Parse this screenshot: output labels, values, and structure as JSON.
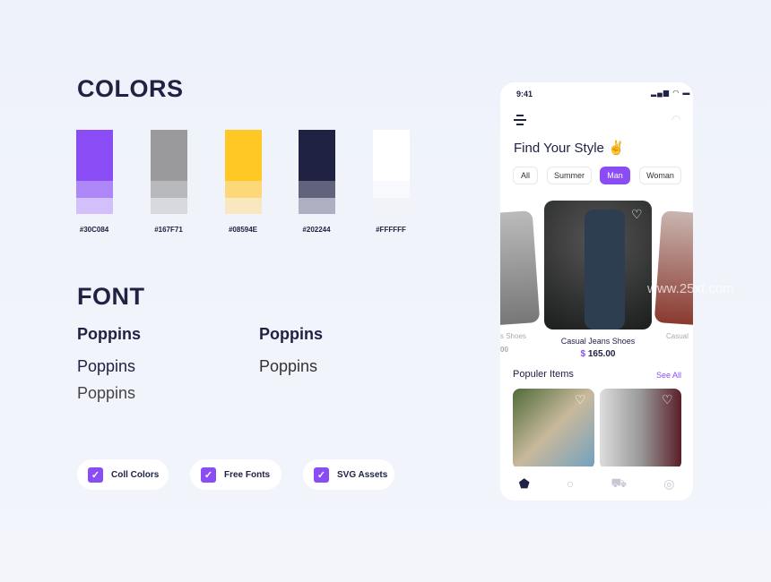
{
  "colors": {
    "title": "COLORS",
    "swatches": [
      {
        "label": "#30C084",
        "main": "#8a4df5",
        "mid": "#ad86f8",
        "light": "#d3c0fb"
      },
      {
        "label": "#167F71",
        "main": "#9a9a9c",
        "mid": "#b8b9bc",
        "light": "#d7d9df"
      },
      {
        "label": "#08594E",
        "main": "#ffc824",
        "mid": "#fdd878",
        "light": "#f9e8bf"
      },
      {
        "label": "#202244",
        "main": "#202244",
        "mid": "#61637d",
        "light": "#aeb0c1"
      },
      {
        "label": "#FFFFFF",
        "main": "#ffffff",
        "mid": "#f8f9fc",
        "light": "#f1f3f9"
      }
    ]
  },
  "font": {
    "title": "FONT",
    "samples": [
      "Poppins",
      "Poppins",
      "Poppins",
      "Poppins",
      "Poppins"
    ]
  },
  "badges": [
    "Coll Colors",
    "Free Fonts",
    "SVG Assets"
  ],
  "phone": {
    "time": "9:41",
    "title": "Find Your Style",
    "emoji": "✌",
    "chips": [
      "All",
      "Summer",
      "Man",
      "Woman"
    ],
    "active_chip": "Man",
    "featured": {
      "name": "Casual Jeans Shoes",
      "currency": "$",
      "price": "165.00"
    },
    "left_card": {
      "name": "s Shoes",
      "price": "00"
    },
    "right_card": {
      "name": "Casual",
      "price": "$"
    },
    "section_title": "Populer Items",
    "see_all": "See All"
  },
  "watermark": "www.25xt.com"
}
